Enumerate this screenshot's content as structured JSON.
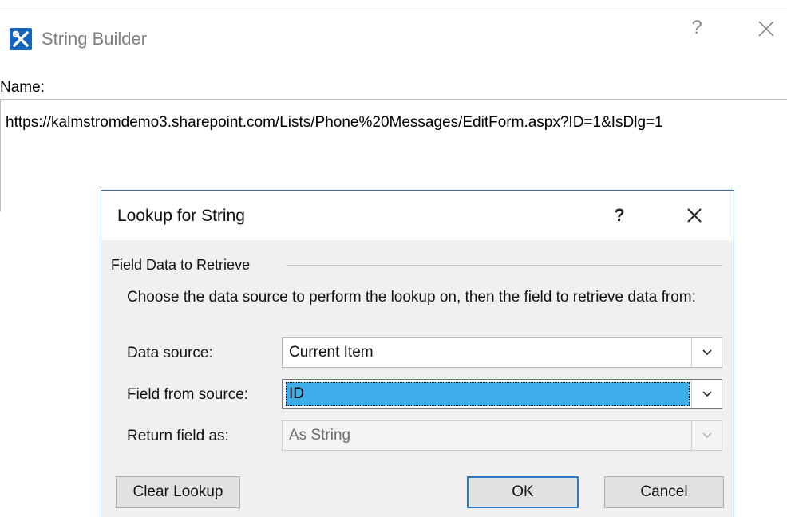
{
  "outer_window": {
    "title": "String Builder",
    "help_label": "?",
    "name_label": "Name:",
    "name_value": "https://kalmstromdemo3.sharepoint.com/Lists/Phone%20Messages/EditForm.aspx?ID=1&IsDlg=1"
  },
  "dialog": {
    "title": "Lookup for String",
    "help_label": "?",
    "group_label": "Field Data to Retrieve",
    "instruction": "Choose the data source to perform the lookup on, then the field to retrieve data from:",
    "fields": {
      "data_source": {
        "label": "Data source:",
        "value": "Current Item"
      },
      "field_from_source": {
        "label": "Field from source:",
        "value": "ID"
      },
      "return_field_as": {
        "label": "Return field as:",
        "value": "As String"
      }
    },
    "buttons": {
      "clear_lookup": "Clear Lookup",
      "ok": "OK",
      "cancel": "Cancel"
    }
  },
  "colors": {
    "accent": "#2b6fb5",
    "selection": "#3daee9",
    "app_icon": "#1565c0"
  },
  "icons": {
    "app": "tools-icon",
    "outer_close": "close-icon",
    "dialog_close": "close-icon",
    "dropdown": "chevron-down-icon"
  }
}
